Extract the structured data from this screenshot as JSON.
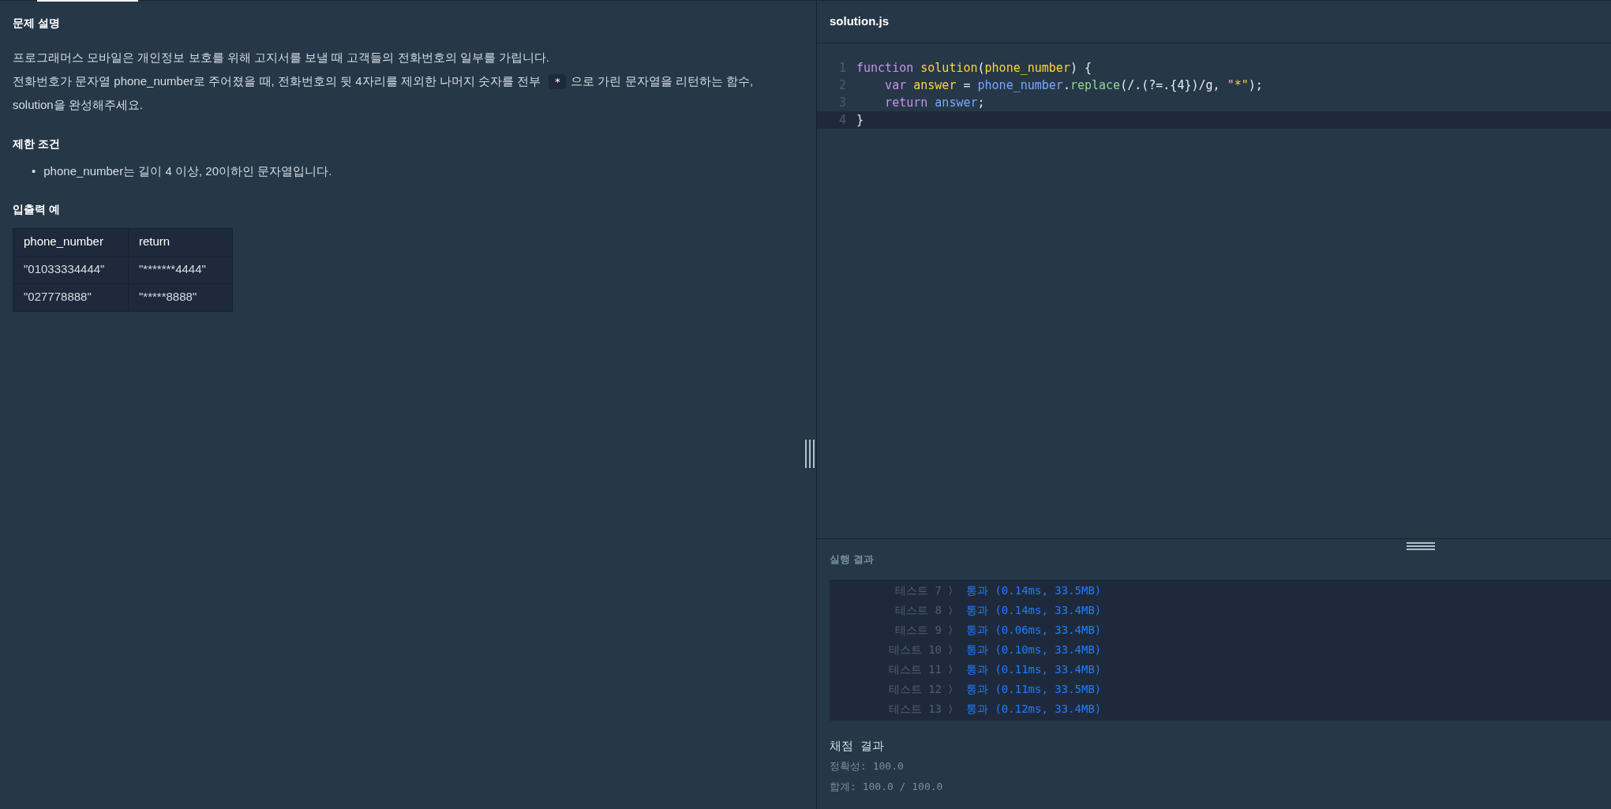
{
  "description": {
    "title": "문제 설명",
    "paragraphs": [
      [
        {
          "kind": "text",
          "text": "프로그래머스 모바일은 개인정보 보호를 위해 고지서를 보낼 때 고객들의 전화번호의 일부를 가립니다."
        }
      ],
      [
        {
          "kind": "text",
          "text": "전화번호가 문자열 phone_number로 주어졌을 때, 전화번호의 뒷 4자리를 제외한 나머지 숫자를 전부 "
        },
        {
          "kind": "code",
          "text": "*"
        },
        {
          "kind": "text",
          "text": "으로 가린 문자열을 리턴하는 함수,"
        }
      ],
      [
        {
          "kind": "text",
          "text": "solution을 완성해주세요."
        }
      ]
    ],
    "constraints_title": "제한 조건",
    "constraints": [
      {
        "marker": "•",
        "text": "phone_number는 길이 4 이상, 20이하인 문자열입니다."
      }
    ],
    "examples_title": "입출력 예",
    "table": {
      "columns": [
        "phone_number",
        "return"
      ],
      "rows": [
        [
          "\"01033334444\"",
          "\"*******4444\""
        ],
        [
          "\"027778888\"",
          "\"*****8888\""
        ]
      ]
    }
  },
  "editor": {
    "filename": "solution.js",
    "lines": [
      {
        "number": "1",
        "current": false,
        "tokens": [
          {
            "kind": "keyword",
            "text": "function"
          },
          {
            "kind": "name",
            "text": " solution"
          },
          {
            "kind": "plain",
            "text": "("
          },
          {
            "kind": "name",
            "text": "phone_number"
          },
          {
            "kind": "plain",
            "text": ") {"
          }
        ]
      },
      {
        "number": "2",
        "current": false,
        "tokens": [
          {
            "kind": "keyword",
            "text": "    var"
          },
          {
            "kind": "name",
            "text": " answer"
          },
          {
            "kind": "plain",
            "text": " = "
          },
          {
            "kind": "variable",
            "text": "phone_number"
          },
          {
            "kind": "plain",
            "text": "."
          },
          {
            "kind": "method",
            "text": "replace"
          },
          {
            "kind": "plain",
            "text": "(/.(?=.{4})/g, "
          },
          {
            "kind": "string",
            "text": "\"*\""
          },
          {
            "kind": "plain",
            "text": ");"
          }
        ]
      },
      {
        "number": "3",
        "current": false,
        "tokens": [
          {
            "kind": "keyword",
            "text": "    return"
          },
          {
            "kind": "variable",
            "text": " answer"
          },
          {
            "kind": "plain",
            "text": ";"
          }
        ]
      },
      {
        "number": "4",
        "current": true,
        "tokens": [
          {
            "kind": "plain",
            "text": "}"
          }
        ]
      }
    ]
  },
  "results": {
    "title": "실행 결과",
    "tests": [
      {
        "label": "테스트 7",
        "arrow": "〉",
        "result": "통과 (0.14ms, 33.5MB)"
      },
      {
        "label": "테스트 8",
        "arrow": "〉",
        "result": "통과 (0.14ms, 33.4MB)"
      },
      {
        "label": "테스트 9",
        "arrow": "〉",
        "result": "통과 (0.06ms, 33.4MB)"
      },
      {
        "label": "테스트 10",
        "arrow": "〉",
        "result": "통과 (0.10ms, 33.4MB)"
      },
      {
        "label": "테스트 11",
        "arrow": "〉",
        "result": "통과 (0.11ms, 33.4MB)"
      },
      {
        "label": "테스트 12",
        "arrow": "〉",
        "result": "통과 (0.11ms, 33.5MB)"
      },
      {
        "label": "테스트 13",
        "arrow": "〉",
        "result": "통과 (0.12ms, 33.4MB)"
      }
    ],
    "grading_title": "채점 결과",
    "grading": [
      "정확성: 100.0",
      "합계: 100.0 / 100.0"
    ]
  }
}
